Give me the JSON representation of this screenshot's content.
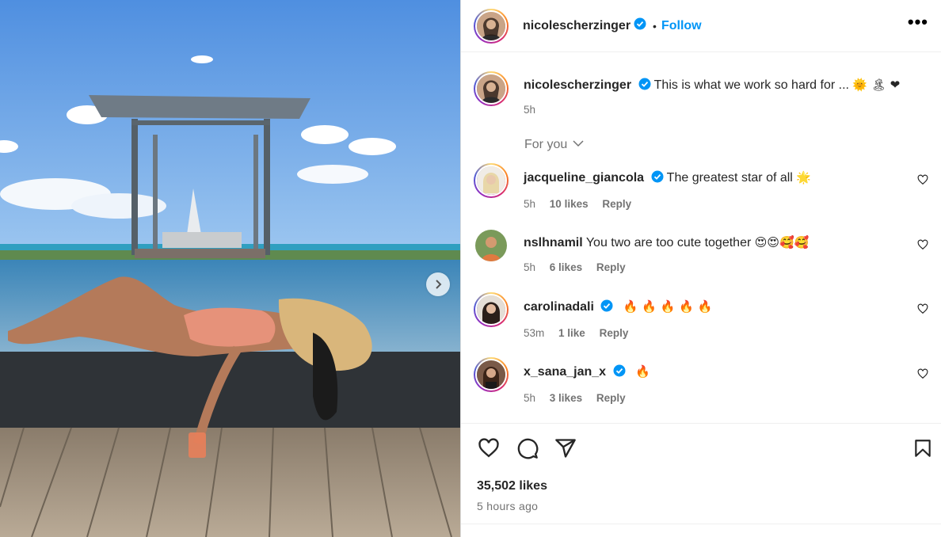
{
  "post": {
    "username": "nicolescherzinger",
    "follow_label": "Follow",
    "dot": "•",
    "more_icon": "•••",
    "caption": {
      "username": "nicolescherzinger",
      "text": "This is what we work so hard for ...",
      "emojis": "🌞 🏝 ❤",
      "time": "5h"
    },
    "filter_label": "For you",
    "comments": [
      {
        "username": "jacqueline_giancola",
        "verified": true,
        "text": "The greatest star of all",
        "emoji": "🌟",
        "time": "5h",
        "likes": "10 likes",
        "reply": "Reply"
      },
      {
        "username": "nslhnamil",
        "verified": false,
        "text": "You two are too cute together",
        "emoji": "😍😍🥰🥰",
        "time": "5h",
        "likes": "6 likes",
        "reply": "Reply"
      },
      {
        "username": "carolinadali",
        "verified": true,
        "text": "",
        "emoji": "🔥 🔥 🔥 🔥 🔥",
        "time": "53m",
        "likes": "1 like",
        "reply": "Reply"
      },
      {
        "username": "x_sana_jan_x",
        "verified": true,
        "text": "",
        "emoji": "🔥",
        "time": "5h",
        "likes": "3 likes",
        "reply": "Reply"
      }
    ],
    "like_count": "35,502 likes",
    "posted_ago": "5 hours ago"
  },
  "icons": {
    "verified": "verified-badge-icon",
    "like": "heart-icon",
    "comment": "comment-bubble-icon",
    "share": "paper-plane-icon",
    "save": "bookmark-icon",
    "next": "chevron-right-icon"
  },
  "colors": {
    "follow": "#0095f6",
    "verified": "#0095f6",
    "muted": "#737373"
  }
}
